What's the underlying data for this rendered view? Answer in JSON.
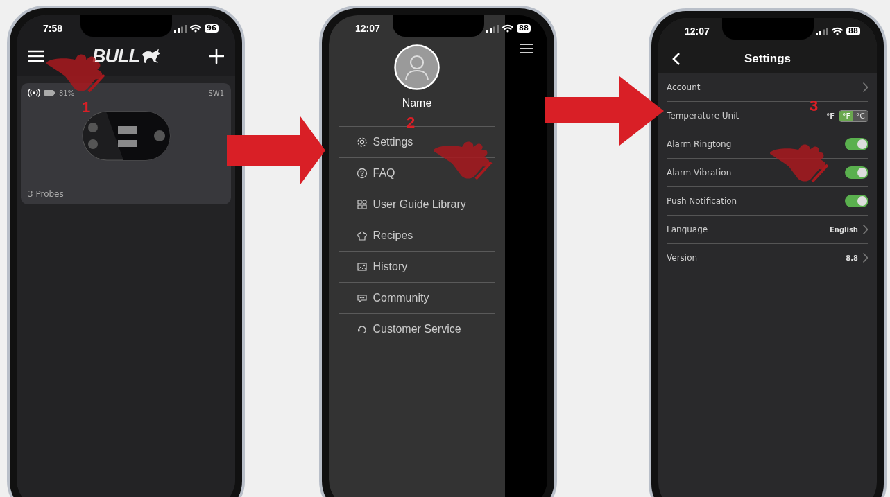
{
  "phones": [
    {
      "kind": "home",
      "status": {
        "time": "7:58",
        "battery": "96"
      },
      "step": "1",
      "header": {
        "logo": "BULL"
      },
      "devices": [
        {
          "battery": "81%",
          "name": "SW1",
          "probes": "3 Probes"
        }
      ]
    },
    {
      "kind": "menu",
      "status": {
        "time": "12:07",
        "battery": "88"
      },
      "step": "2",
      "profile": {
        "name": "Name"
      },
      "menu": [
        {
          "label": "Settings"
        },
        {
          "label": "FAQ"
        },
        {
          "label": "User Guide Library"
        },
        {
          "label": "Recipes"
        },
        {
          "label": "History"
        },
        {
          "label": "Community"
        },
        {
          "label": "Customer Service"
        }
      ]
    },
    {
      "kind": "settings",
      "status": {
        "time": "12:07",
        "battery": "88"
      },
      "step": "3",
      "title": "Settings",
      "rows": [
        {
          "kind": "link",
          "label": "Account"
        },
        {
          "kind": "unit",
          "label": "Temperature Unit",
          "value": "°F",
          "options": [
            {
              "label": "°F",
              "selected": true
            },
            {
              "label": "°C",
              "selected": false
            }
          ]
        },
        {
          "kind": "toggle",
          "label": "Alarm Ringtong",
          "on": true
        },
        {
          "kind": "toggle",
          "label": "Alarm Vibration",
          "on": true
        },
        {
          "kind": "toggle",
          "label": "Push Notification",
          "on": true
        },
        {
          "kind": "link",
          "label": "Language",
          "value": "English"
        },
        {
          "kind": "link",
          "label": "Version",
          "value": "8.8"
        }
      ]
    }
  ]
}
